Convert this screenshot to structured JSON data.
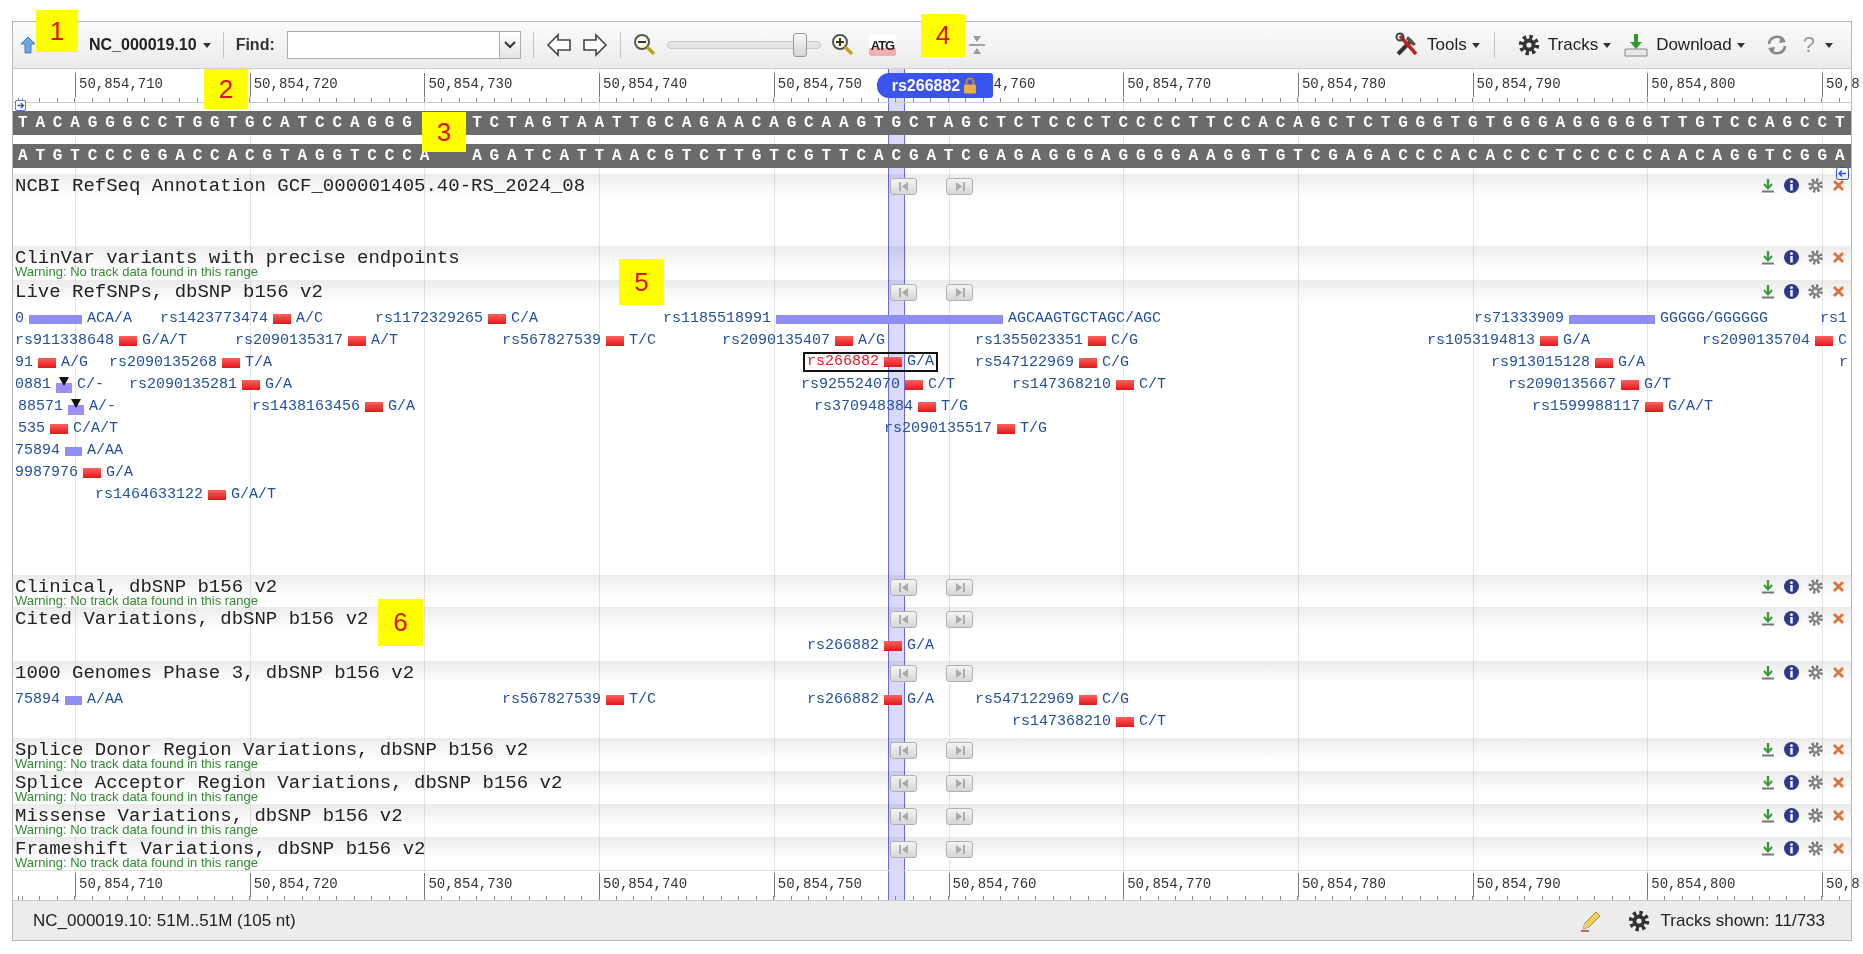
{
  "toolbar": {
    "sequence_menu": "NC_000019.10",
    "find_label": "Find:",
    "zoom": {
      "level": 0.9
    },
    "sequence_view_button": "ATG",
    "menus": [
      {
        "label": "Tools",
        "kind": "tools"
      },
      {
        "label": "Tracks",
        "kind": "tracks"
      },
      {
        "label": "Download",
        "kind": "download"
      }
    ],
    "help": "?"
  },
  "ruler": {
    "ticks": [
      "50,854,710",
      "50,854,720",
      "50,854,730",
      "50,854,740",
      "50,854,750",
      "4,760",
      "50,854,770",
      "50,854,780",
      "50,854,790",
      "50,854,800",
      "50,8"
    ]
  },
  "marker": {
    "label": "rs266882",
    "locked": true
  },
  "sequence": {
    "forward": [
      "TACAGGGCCTGGTGCATCCAGGG",
      "TCTAGTAATTGCAGAACAGCAAGTGCTAGCTCTCCCTCCCCTTCCACAGCTCTGGGTGTGGGAGGGGGTTGTCCAGCCT"
    ],
    "reverse": [
      "ATGTCCCGGACCACGTAGGTCCCA",
      "AGATCATTAACGTCTTGTCGTTCACGATCGAGAGGGAGGGGAAGGTGTCGAGACCCACACCCTCCCCCAACAGGTCGGA"
    ]
  },
  "tracks": [
    {
      "name": "NCBI RefSeq Annotation GCF_000001405.40-RS_2024_08",
      "nav_buttons": true
    },
    {
      "name": "ClinVar variants with precise endpoints",
      "warning": "Warning: No track data found in this range",
      "nav_buttons": false
    },
    {
      "name": "Live RefSNPs, dbSNP b156 v2",
      "nav_buttons": true,
      "lanes": [
        [
          {
            "label": "0",
            "kind": "indel",
            "allele": "ACA/A",
            "selected": false
          },
          {
            "label": "rs1423773474",
            "kind": "snv",
            "allele": "A/C",
            "selected": false
          },
          {
            "label": "rs1172329265",
            "kind": "snv",
            "allele": "C/A",
            "selected": false
          },
          {
            "label": "rs1185518991",
            "kind": "indel",
            "allele": "AGCAAGTGCTAGC/AGC",
            "selected": false
          },
          {
            "label": "rs71333909",
            "kind": "indel",
            "allele": "GGGGG/GGGGGG",
            "selected": false
          },
          {
            "label": "rs1",
            "kind": "label",
            "selected": false
          }
        ],
        [
          {
            "label": "rs911338648",
            "kind": "snv",
            "allele": "G/A/T",
            "selected": false
          },
          {
            "label": "rs2090135317",
            "kind": "snv",
            "allele": "A/T",
            "selected": false
          },
          {
            "label": "rs567827539",
            "kind": "snv",
            "allele": "T/C",
            "selected": false
          },
          {
            "label": "rs2090135407",
            "kind": "snv",
            "allele": "A/G",
            "selected": false
          },
          {
            "label": "rs1355023351",
            "kind": "snv",
            "allele": "C/G",
            "selected": false
          },
          {
            "label": "rs1053194813",
            "kind": "snv",
            "allele": "G/A",
            "selected": false
          },
          {
            "label": "rs2090135704",
            "kind": "snv",
            "allele": "C",
            "selected": false
          }
        ],
        [
          {
            "label": "91",
            "kind": "snv",
            "allele": "A/G",
            "selected": false
          },
          {
            "label": "rs2090135268",
            "kind": "snv",
            "allele": "T/A",
            "selected": false
          },
          {
            "label": "rs266882",
            "kind": "snv",
            "allele": "G/A",
            "selected": true
          },
          {
            "label": "rs547122969",
            "kind": "snv",
            "allele": "C/G",
            "selected": false
          },
          {
            "label": "rs913015128",
            "kind": "snv",
            "allele": "G/A",
            "selected": false
          },
          {
            "label": "r",
            "kind": "label",
            "selected": false
          }
        ],
        [
          {
            "label": "0881",
            "kind": "deletion",
            "allele": "C/-",
            "selected": false
          },
          {
            "label": "rs2090135281",
            "kind": "snv",
            "allele": "G/A",
            "selected": false
          },
          {
            "label": "rs925524070",
            "kind": "snv",
            "allele": "C/T",
            "selected": false
          },
          {
            "label": "rs147368210",
            "kind": "snv",
            "allele": "C/T",
            "selected": false
          },
          {
            "label": "rs2090135667",
            "kind": "snv",
            "allele": "G/T",
            "selected": false
          }
        ],
        [
          {
            "label": "88571",
            "kind": "deletion",
            "allele": "A/-",
            "selected": false
          },
          {
            "label": "rs1438163456",
            "kind": "snv",
            "allele": "G/A",
            "selected": false
          },
          {
            "label": "rs370948384",
            "kind": "snv",
            "allele": "T/G",
            "selected": false
          },
          {
            "label": "rs1599988117",
            "kind": "snv",
            "allele": "G/A/T",
            "selected": false
          }
        ],
        [
          {
            "label": "535",
            "kind": "snv",
            "allele": "C/A/T",
            "selected": false
          },
          {
            "label": "rs2090135517",
            "kind": "snv",
            "allele": "T/G",
            "selected": false
          }
        ],
        [
          {
            "label": "75894",
            "kind": "indel",
            "allele": "A/AA",
            "selected": false
          }
        ],
        [
          {
            "label": "9987976",
            "kind": "snv",
            "allele": "G/A",
            "selected": false
          }
        ],
        [
          {
            "label": "rs1464633122",
            "kind": "snv",
            "allele": "G/A/T",
            "selected": false
          }
        ]
      ]
    },
    {
      "name": "Clinical, dbSNP b156 v2",
      "warning": "Warning: No track data found in this range",
      "nav_buttons": true
    },
    {
      "name": "Cited Variations, dbSNP b156 v2",
      "nav_buttons": true,
      "lanes": [
        [
          {
            "label": "rs266882",
            "kind": "snv",
            "allele": "G/A",
            "selected": false
          }
        ]
      ]
    },
    {
      "name": "1000 Genomes Phase 3, dbSNP b156 v2",
      "nav_buttons": true,
      "lanes": [
        [
          {
            "label": "75894",
            "kind": "indel",
            "allele": "A/AA",
            "selected": false
          },
          {
            "label": "rs567827539",
            "kind": "snv",
            "allele": "T/C",
            "selected": false
          },
          {
            "label": "rs266882",
            "kind": "snv",
            "allele": "G/A",
            "selected": false
          },
          {
            "label": "rs547122969",
            "kind": "snv",
            "allele": "C/G",
            "selected": false
          }
        ],
        [
          {
            "label": "rs147368210",
            "kind": "snv",
            "allele": "C/T",
            "selected": false
          }
        ]
      ]
    },
    {
      "name": "Splice Donor Region Variations, dbSNP b156 v2",
      "warning": "Warning: No track data found in this range",
      "nav_buttons": true
    },
    {
      "name": "Splice Acceptor Region Variations, dbSNP b156 v2",
      "warning": "Warning: No track data found in this range",
      "nav_buttons": true
    },
    {
      "name": "Missense Variations, dbSNP b156 v2",
      "warning": "Warning: No track data found in this range",
      "nav_buttons": true
    },
    {
      "name": "Frameshift Variations, dbSNP b156 v2",
      "warning": "Warning: No track data found in this range",
      "nav_buttons": true
    }
  ],
  "bottom_ruler": {
    "ticks": [
      "50,854,710",
      "50,854,720",
      "50,854,730",
      "50,854,740",
      "50,854,750",
      "50,854,760",
      "50,854,770",
      "50,854,780",
      "50,854,790",
      "50,854,800",
      "50,8"
    ]
  },
  "status_bar": {
    "location": "NC_000019.10: 51M..51M (105 nt)",
    "tracks_shown": "Tracks shown: 11/733"
  },
  "callouts": [
    "1",
    "2",
    "3",
    "4",
    "5",
    "6"
  ]
}
